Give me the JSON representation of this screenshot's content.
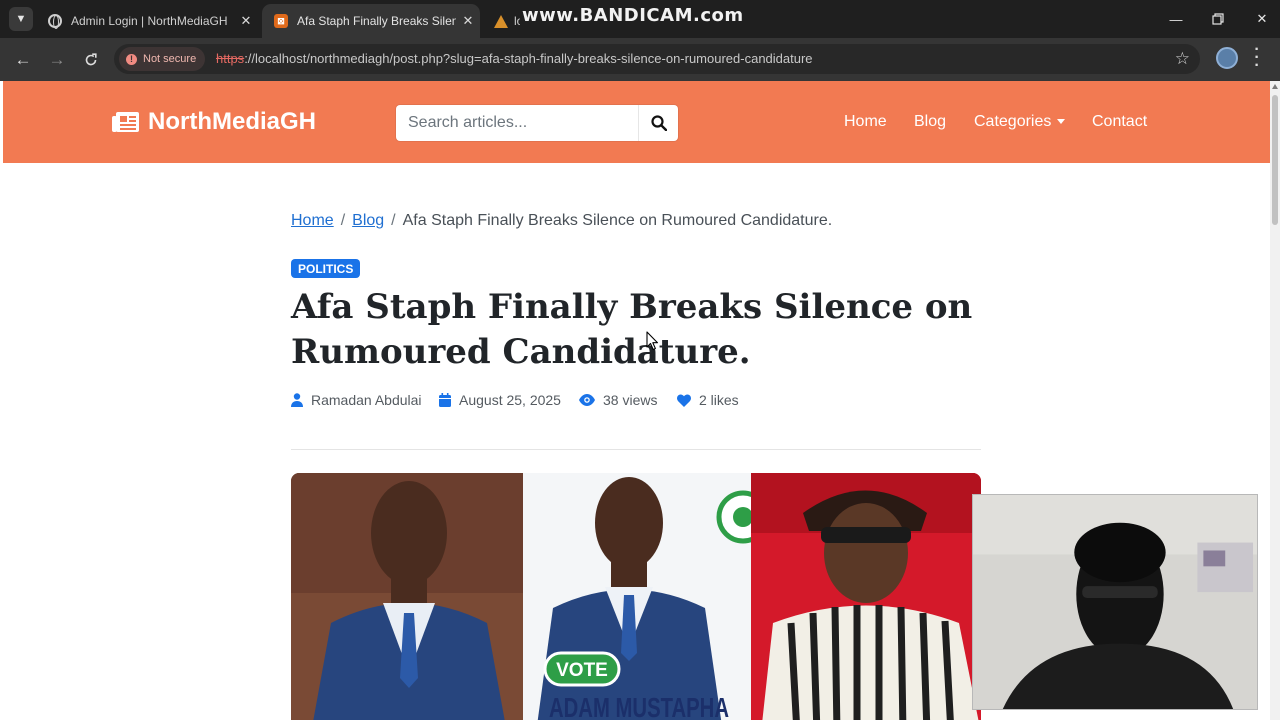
{
  "browser": {
    "tabs": [
      {
        "title": "Admin Login | NorthMediaGH",
        "icon": "globe-icon",
        "active": false
      },
      {
        "title": "Afa Staph Finally Breaks Silence",
        "icon": "xampp-icon",
        "active": true
      },
      {
        "title": "lo",
        "icon": "cone-icon",
        "active": false
      }
    ],
    "watermark": "www.BANDICAM.com",
    "security_label": "Not secure",
    "url_protocol": "https",
    "url_rest": "://localhost/northmediagh/post.php?slug=afa-staph-finally-breaks-silence-on-rumoured-candidature"
  },
  "site": {
    "brand": "NorthMediaGH",
    "brand_color": "#f27a52",
    "search_placeholder": "Search articles...",
    "nav": {
      "home": "Home",
      "blog": "Blog",
      "categories": "Categories",
      "contact": "Contact"
    }
  },
  "breadcrumb": {
    "home": "Home",
    "blog": "Blog",
    "current": "Afa Staph Finally Breaks Silence on Rumoured Candidature."
  },
  "post": {
    "category": "POLITICS",
    "category_color": "#1a73e8",
    "title": "Afa Staph Finally Breaks Silence on Rumoured Candidature.",
    "author": "Ramadan Abdulai",
    "date": "August 25, 2025",
    "views": "38 views",
    "likes": "2 likes",
    "image": {
      "badge_text": "VOTE",
      "name_text": "ADAM MUSTAPHA"
    }
  }
}
